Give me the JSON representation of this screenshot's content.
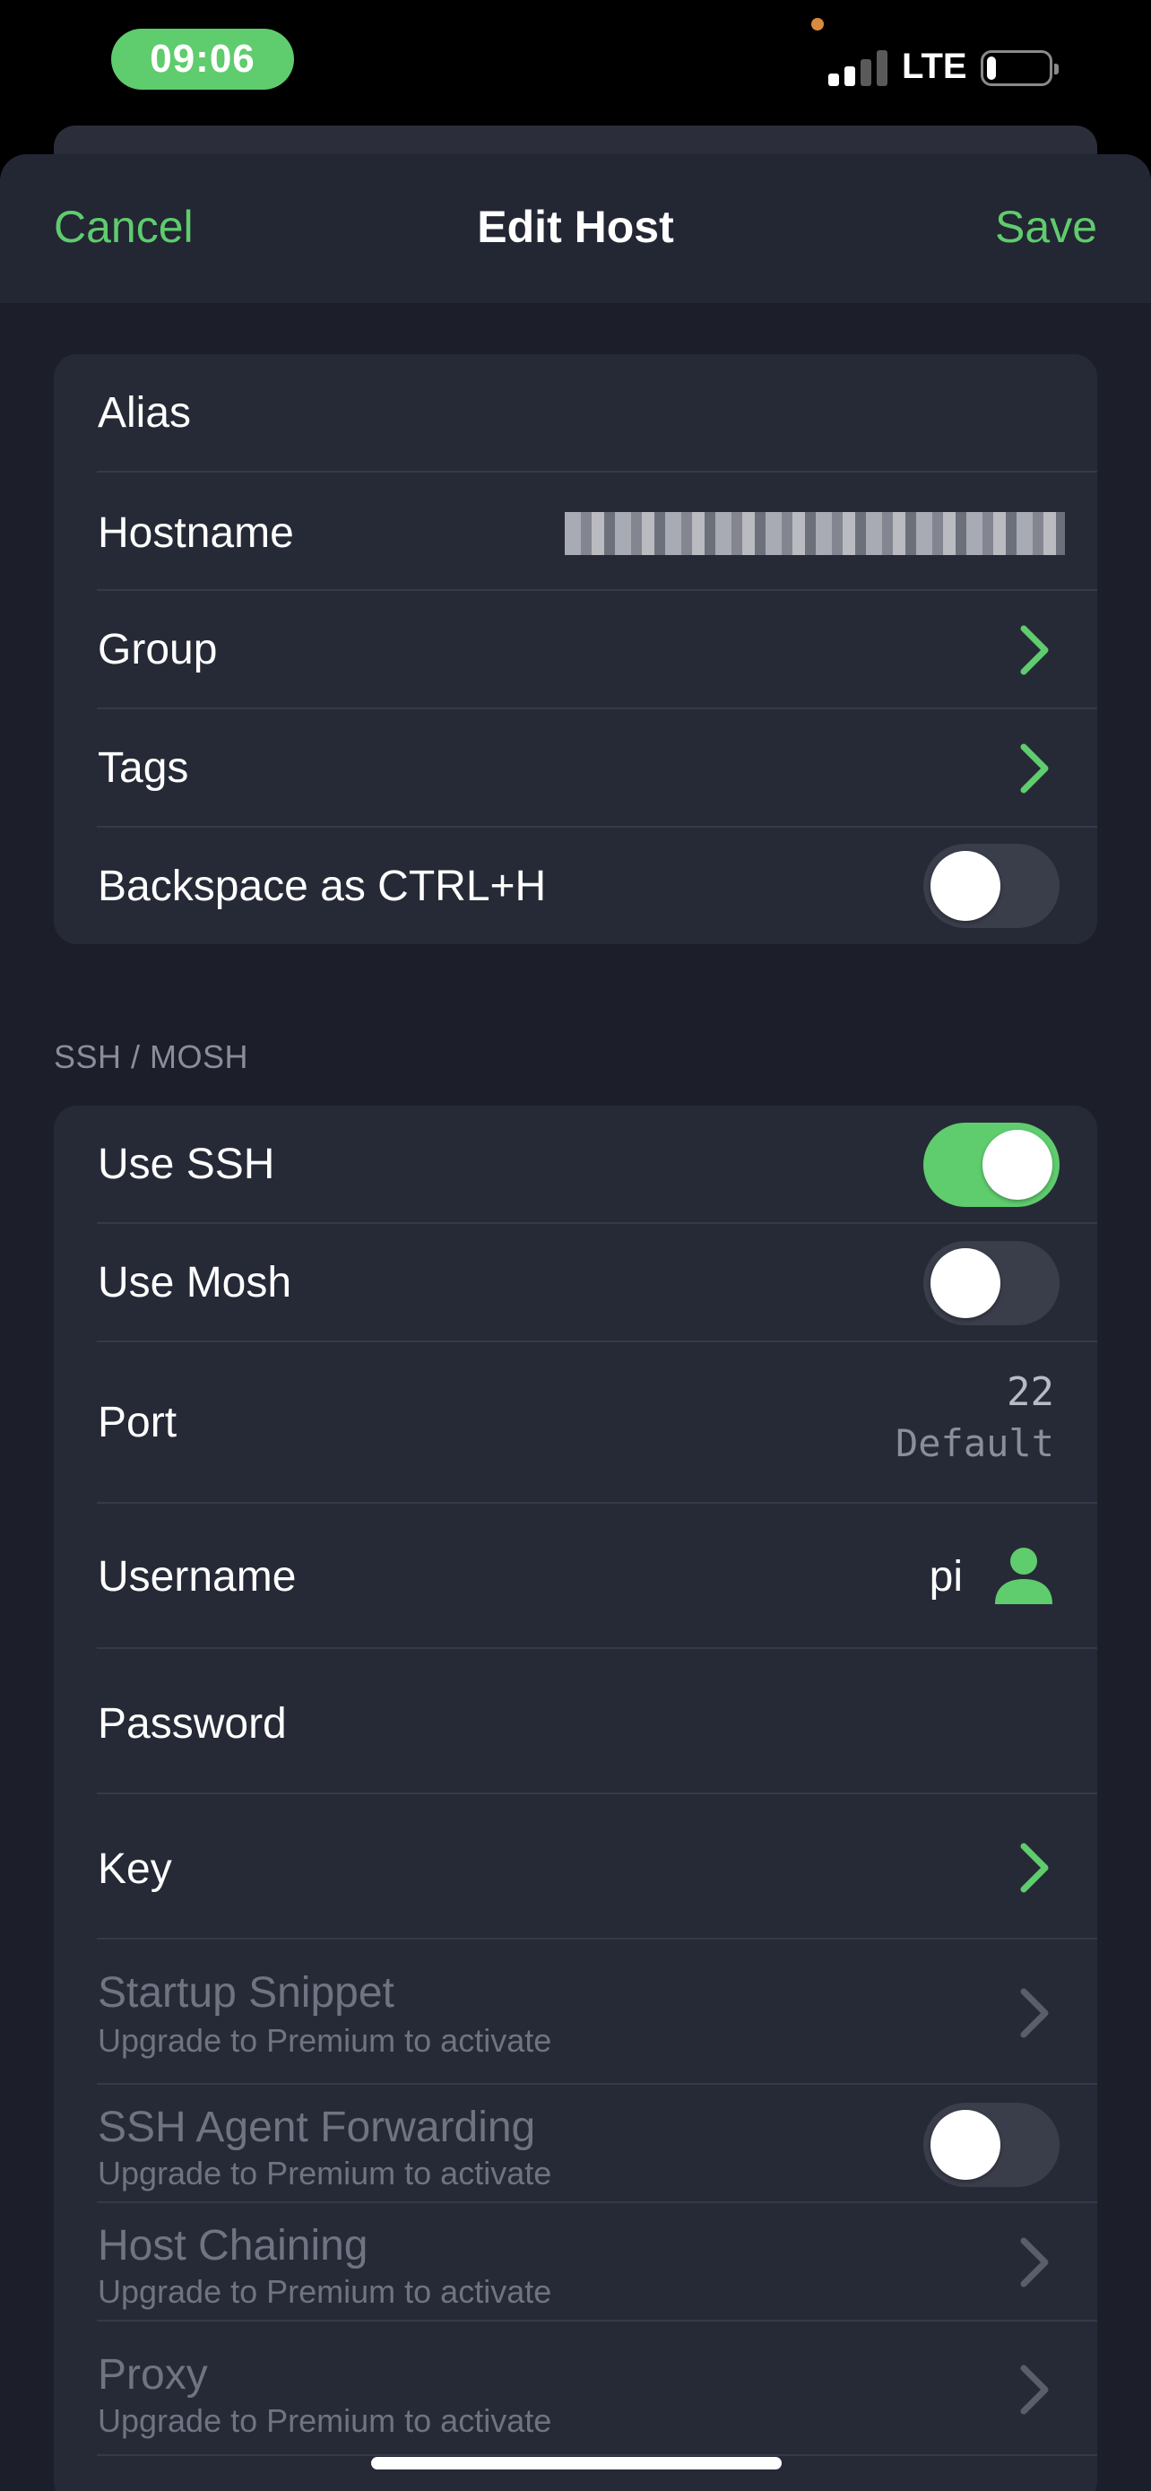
{
  "status_bar": {
    "time": "09:06",
    "network": "LTE",
    "battery_level_percent": 15,
    "signal_bars_active": 2
  },
  "nav": {
    "cancel_label": "Cancel",
    "title": "Edit Host",
    "save_label": "Save"
  },
  "general": {
    "alias_label": "Alias",
    "hostname_label": "Hostname",
    "hostname_value_redacted": true,
    "group_label": "Group",
    "tags_label": "Tags",
    "backspace_label": "Backspace as CTRL+H",
    "backspace_enabled": false
  },
  "ssh": {
    "section_title": "SSH / MOSH",
    "use_ssh_label": "Use SSH",
    "use_ssh_enabled": true,
    "use_mosh_label": "Use Mosh",
    "use_mosh_enabled": false,
    "port_label": "Port",
    "port_value": "22",
    "port_hint": "Default",
    "username_label": "Username",
    "username_value": "pi",
    "password_label": "Password",
    "key_label": "Key",
    "startup_snippet_label": "Startup Snippet",
    "startup_snippet_note": "Upgrade to Premium to activate",
    "agent_forwarding_label": "SSH Agent Forwarding",
    "agent_forwarding_note": "Upgrade to Premium to activate",
    "agent_forwarding_enabled": false,
    "host_chaining_label": "Host Chaining",
    "host_chaining_note": "Upgrade to Premium to activate",
    "proxy_label": "Proxy",
    "proxy_note": "Upgrade to Premium to activate"
  },
  "colors": {
    "accent": "#5fcc6e",
    "sheet_background": "#1c1f2a",
    "group_background": "#262a36",
    "muted_text": "#6f7382"
  },
  "icons": {
    "chevron": "chevron-right-icon",
    "user": "person-icon"
  }
}
